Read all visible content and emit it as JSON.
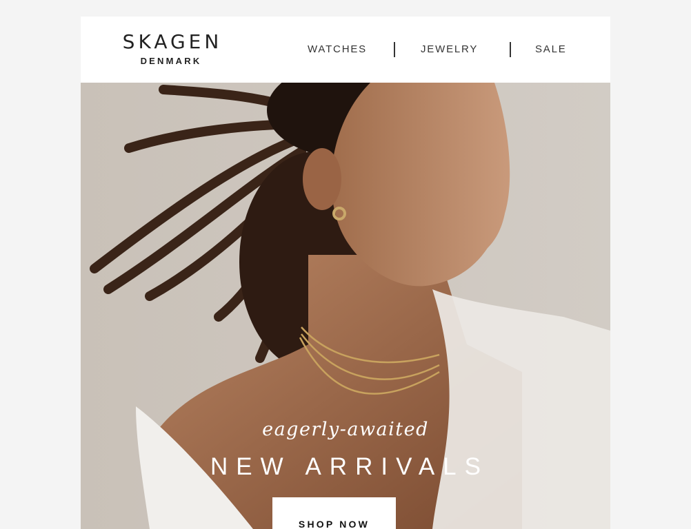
{
  "header": {
    "logo": {
      "name": "SKAGEN",
      "subtitle": "DENMARK"
    },
    "nav": [
      {
        "label": "WATCHES"
      },
      {
        "label": "JEWELRY"
      },
      {
        "label": "SALE"
      }
    ]
  },
  "hero": {
    "tagline": "eagerly-awaited",
    "headline": "NEW ARRIVALS",
    "cta_label": "SHOP NOW"
  }
}
